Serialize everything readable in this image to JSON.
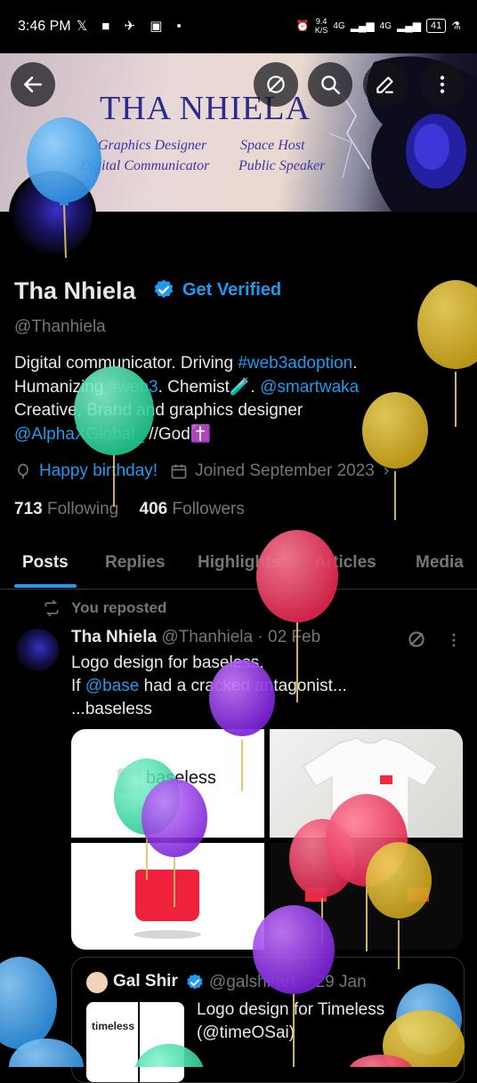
{
  "status_bar": {
    "time": "3:46 PM",
    "left_icons": "𝕏 ■ ✈ ▣ •",
    "net_speed_top": "9.4",
    "net_speed_unit": "K/S",
    "net1": "4G",
    "net2": "4G",
    "battery": "41"
  },
  "banner": {
    "title": "THA NHIELA",
    "left_line1": "Graphics Designer",
    "left_line2": "Digital Communicator",
    "right_line1": "Space Host",
    "right_line2": "Public Speaker"
  },
  "profile": {
    "name": "Tha Nhiela",
    "get_verified": "Get Verified",
    "handle": "@Thanhiela",
    "bio_line1_text": "Digital communicator. Driving ",
    "bio_line1_tag": "#web3adoption",
    "bio_line1_end": ".",
    "bio_line2_text": "Humanizing ",
    "bio_line2_tag": "#web3",
    "bio_line2_mid": ". Chemist🧪. ",
    "bio_line2_mention": "@smartwaka",
    "bio_line3": "Creative, Brand and graphics designer",
    "bio_line4_mention": "@AlphaXGlobal_",
    "bio_line4_end": " //God✝️",
    "birthday": "Happy birthday!",
    "joined": "Joined September 2023",
    "following_count": "713",
    "following_label": "Following",
    "followers_count": "406",
    "followers_label": "Followers"
  },
  "tabs": [
    "Posts",
    "Replies",
    "Highlights",
    "Articles",
    "Media"
  ],
  "post": {
    "repost_label": "You reposted",
    "author": "Tha Nhiela",
    "handle": "@Thanhiela",
    "date": "· 02 Feb",
    "line1": "Logo design for baseless.",
    "line2_pre": "If ",
    "line2_mention": "@base",
    "line2_post": "  had a cracked antagonist...",
    "line3": "...baseless",
    "media_logo_text": "baseless"
  },
  "quote": {
    "author": "Gal Shir",
    "handle": "@galshirart",
    "date": "· 29 Jan",
    "thumb_text": "timeless",
    "line1": "Logo design for Timeless",
    "line2": "(@timeOSai)"
  },
  "colors": {
    "accent": "#1d9bf0",
    "muted": "#71767b",
    "text": "#e7e9ea",
    "background": "#000000"
  }
}
